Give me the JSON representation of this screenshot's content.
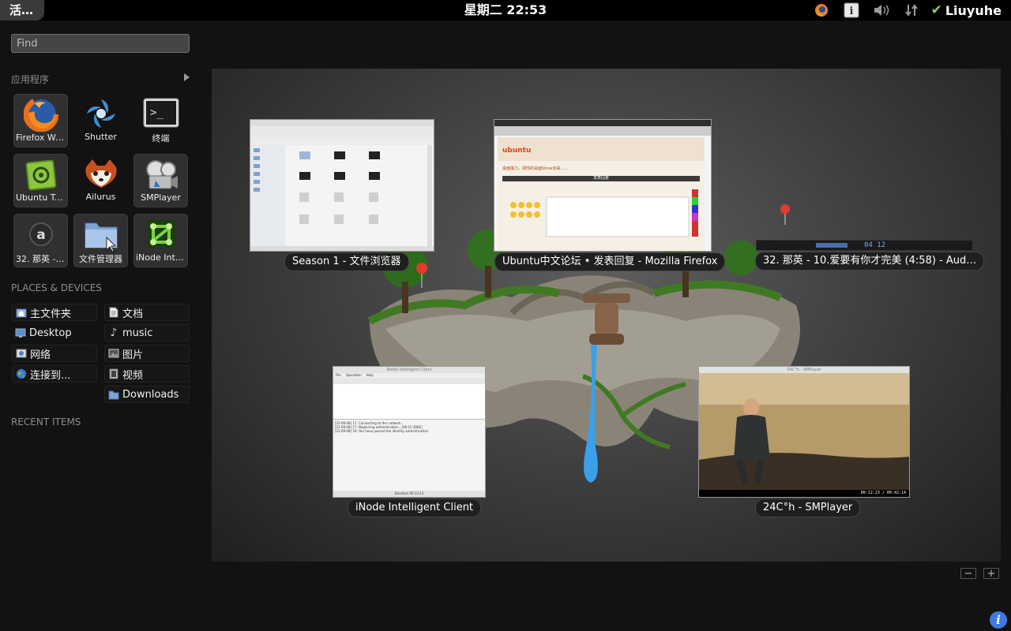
{
  "top_panel": {
    "activities_label": "活…",
    "clock": "星期二 22:53",
    "user": "Liuyuhe"
  },
  "search": {
    "placeholder": "Find"
  },
  "apps": {
    "title": "应用程序",
    "items": [
      {
        "label": "Firefox We…",
        "icon": "firefox-icon"
      },
      {
        "label": "Shutter",
        "icon": "shutter-icon"
      },
      {
        "label": "终端",
        "icon": "terminal-icon"
      },
      {
        "label": "Ubuntu Tw…",
        "icon": "ubuntu-tweak-icon"
      },
      {
        "label": "Ailurus",
        "icon": "ailurus-icon"
      },
      {
        "label": "SMPlayer",
        "icon": "smplayer-icon"
      },
      {
        "label": "32. 那英 - 1…",
        "icon": "audacious-icon"
      },
      {
        "label": "文件管理器",
        "icon": "file-manager-icon"
      },
      {
        "label": "iNode Intel…",
        "icon": "inode-icon"
      }
    ]
  },
  "places": {
    "title": "PLACES & DEVICES",
    "left": [
      "主文件夹",
      "Desktop",
      "网络",
      "连接到..."
    ],
    "right": [
      "文档",
      "music",
      "图片",
      "视频",
      "Downloads"
    ]
  },
  "recent": {
    "title": "RECENT ITEMS"
  },
  "windows": [
    {
      "label": "Season 1 - 文件浏览器"
    },
    {
      "label": "Ubuntu中文论坛 • 发表回复 - Mozilla Firefox"
    },
    {
      "label": "32. 那英 - 10.爱要有你才完美 (4:58) - Aud…",
      "time": "04 12"
    },
    {
      "label": "iNode Intelligent Client",
      "title": "iNode Intelligent Client"
    },
    {
      "label": "24C°h - SMPlayer",
      "title": "24C°h - SMPlayer",
      "time": "00:12:23 / 00:42:14"
    }
  ],
  "firefox_thumb": {
    "brand": "ubuntu",
    "heading": "桌面接力，把你的桌面Show出来……",
    "bar_label": "发表回复"
  },
  "inode_thumb": {
    "menu": [
      "File",
      "Operation",
      "Help"
    ],
    "log": [
      "[22:09:08] 17: Connecting to the network…",
      "[22:09:08] 17: Beginning authentication…[00:1F:3D6E]",
      "[22:09:08] 19: You have passed the identity authentication"
    ],
    "status": "Duration   00:12:13"
  },
  "colors": {
    "panel": "#000000",
    "accent_green": "#8fd14f",
    "info_blue": "#3c7ae0",
    "ubuntu_orange": "#dd4814"
  }
}
